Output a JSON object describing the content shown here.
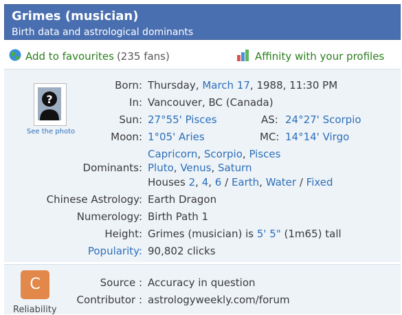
{
  "header": {
    "title": "Grimes (musician)",
    "subtitle": "Birth data and astrological dominants"
  },
  "actions": {
    "favourites_label": "Add to favourites",
    "fans_count": "(235 fans)",
    "affinity_label": "Affinity with your profiles"
  },
  "photo": {
    "link_label": "See the photo"
  },
  "details": {
    "born_label": "Born:",
    "born_day": "Thursday,",
    "born_date_link": "March 17",
    "born_rest": ", 1988, 11:30 PM",
    "in_label": "In:",
    "in_value": "Vancouver, BC (Canada)",
    "sun_label": "Sun:",
    "sun_value": "27°55' Pisces",
    "as_label": "AS:",
    "as_value": "24°27' Scorpio",
    "moon_label": "Moon:",
    "moon_value": "1°05' Aries",
    "mc_label": "MC:",
    "mc_value": "14°14' Virgo",
    "dominants_label": "Dominants:",
    "dominant_signs": [
      "Capricorn",
      "Scorpio",
      "Pisces"
    ],
    "dominant_planets": [
      "Pluto",
      "Venus",
      "Saturn"
    ],
    "houses_prefix": "Houses",
    "houses": [
      "2",
      "4",
      "6"
    ],
    "element": "Earth",
    "element2": "Water",
    "modality": "Fixed",
    "chinese_label": "Chinese Astrology:",
    "chinese_value": "Earth Dragon",
    "numerology_label": "Numerology:",
    "numerology_value": "Birth Path 1",
    "height_label": "Height:",
    "height_name": "Grimes (musician) is",
    "height_ft": "5'",
    "height_in": "5\"",
    "height_metric": "(1m65) tall",
    "popularity_label": "Popularity:",
    "popularity_value": "90,802 clicks"
  },
  "source": {
    "badge_letter": "C",
    "reliability_label": "Reliability",
    "source_label": "Source :",
    "source_value": "Accuracy in question",
    "contributor_label": "Contributor :",
    "contributor_value": "astrologyweekly.com/forum"
  },
  "colors": {
    "header_bg": "#4a6fb0",
    "link": "#2c6fb7",
    "action_green": "#2a7e1c",
    "panel_bg": "#eef3f8",
    "badge_orange": "#e2884a"
  }
}
